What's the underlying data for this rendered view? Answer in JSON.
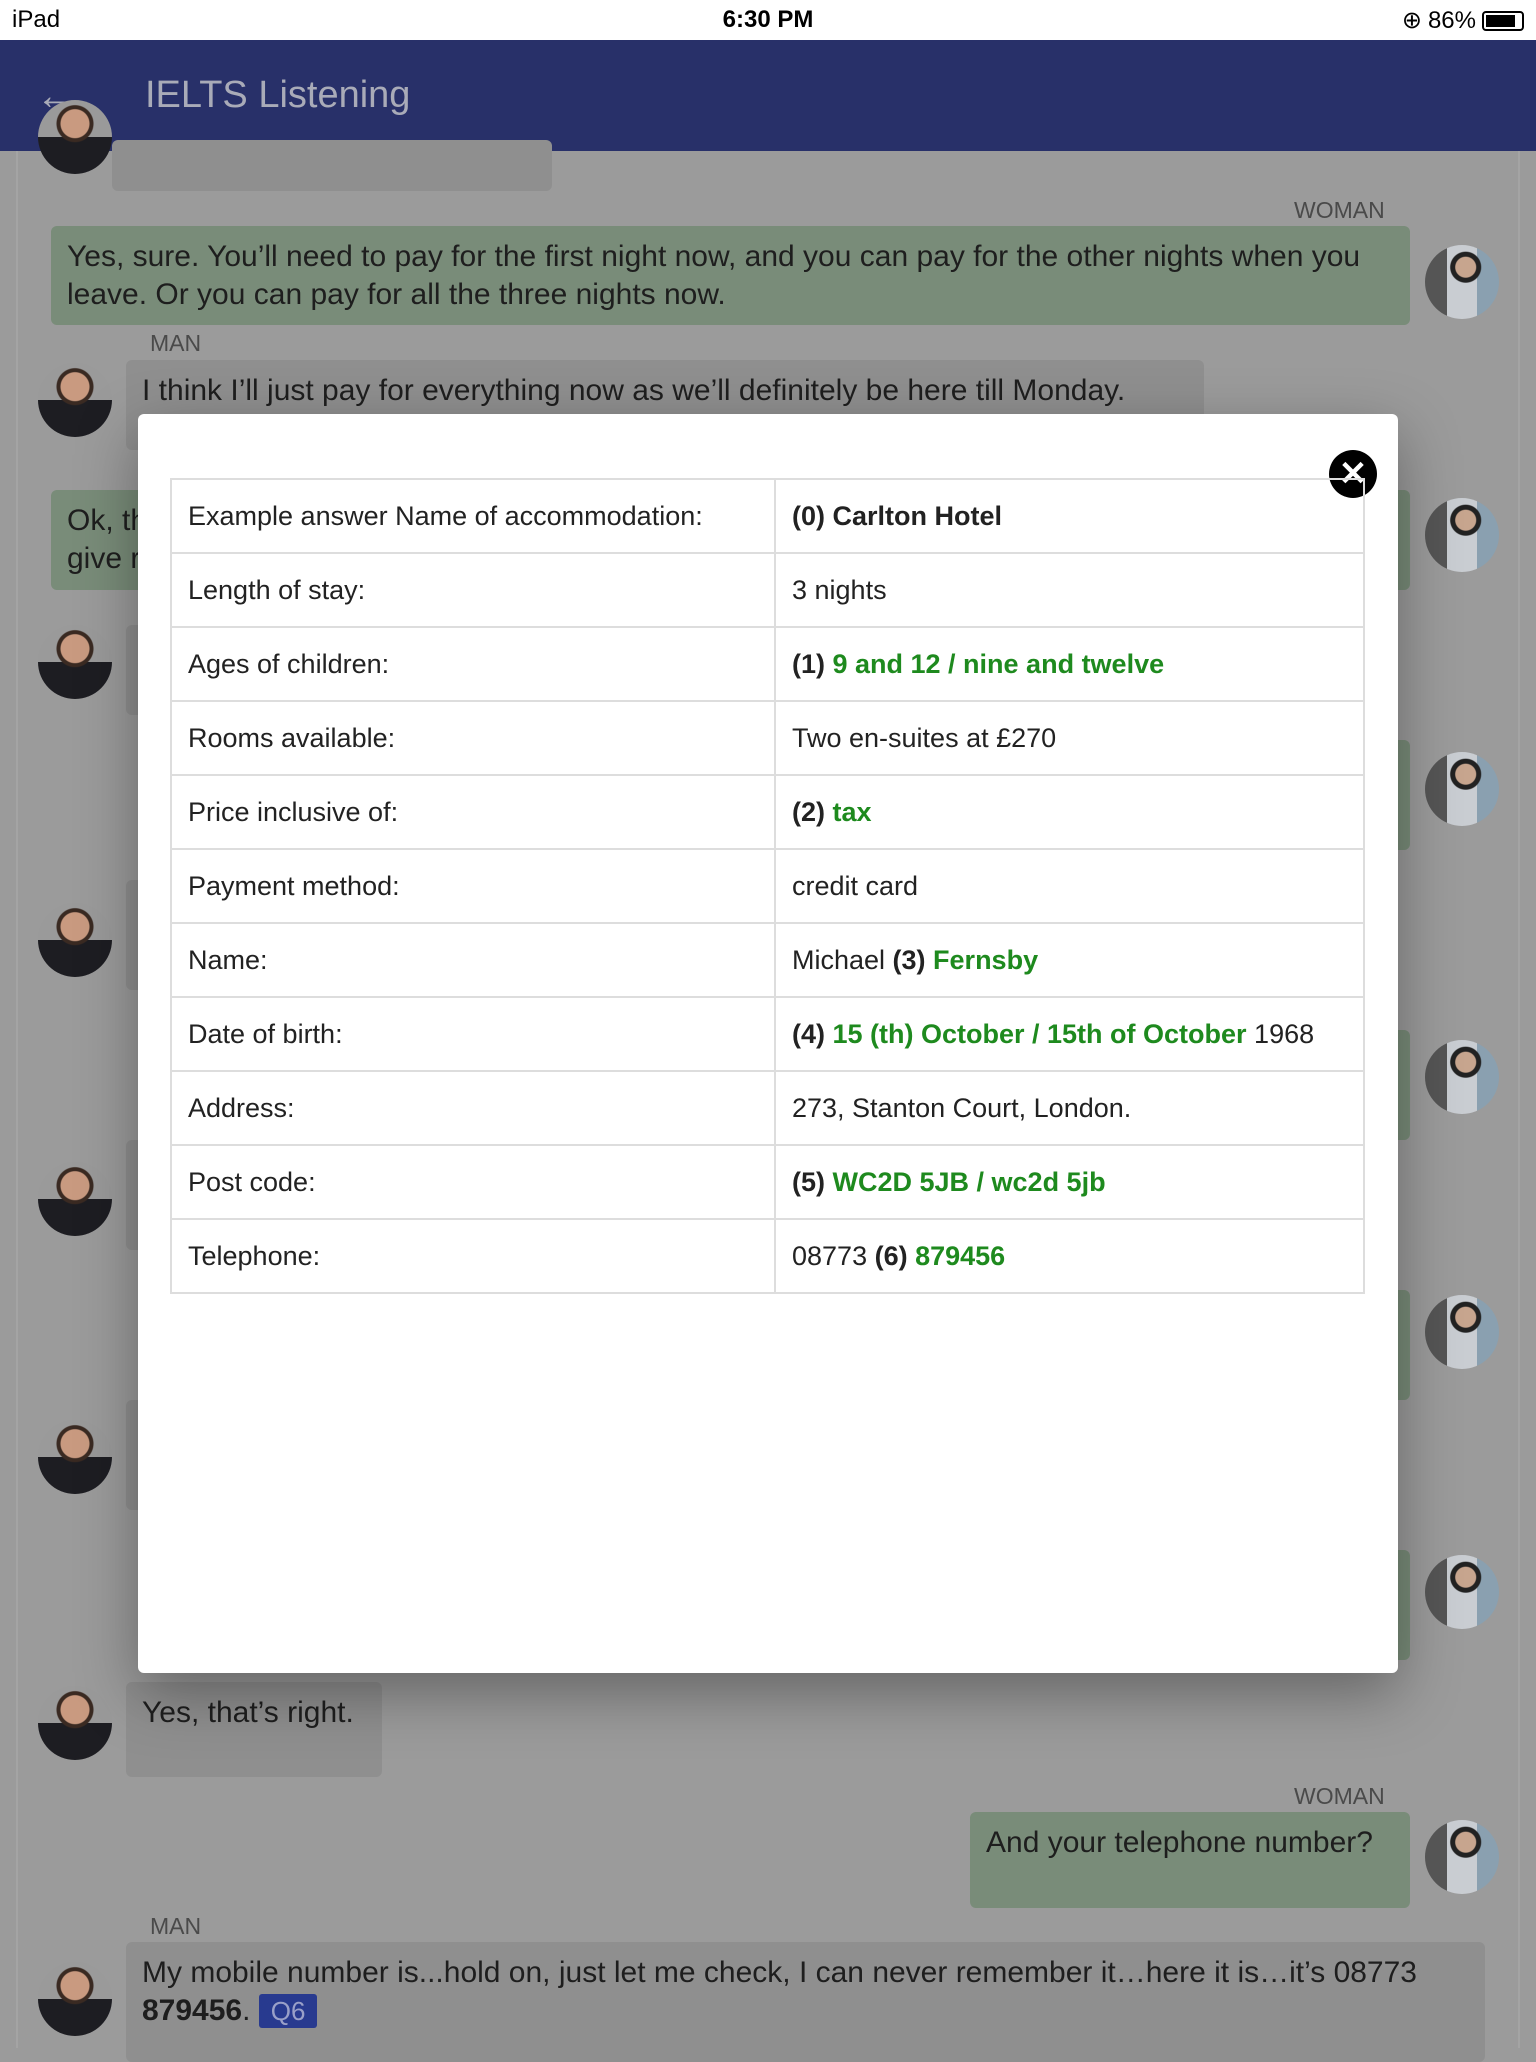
{
  "status": {
    "device": "iPad",
    "time": "6:30 PM",
    "battery": "86%",
    "battery_level": 0.86
  },
  "header": {
    "title": "IELTS Listening",
    "back_icon": "arrow-left-icon"
  },
  "chat": {
    "woman_label": "WOMAN",
    "man_label": "MAN",
    "msg1": "Yes, sure. You’ll need to pay for the first night now, and you can pay for the other nights when you leave. Or you can pay for all the three nights now.",
    "msg2": "I think I’ll just pay for everything now as we’ll definitely be here till Monday.",
    "msg3a": "Ok, th",
    "msg3b": "give r",
    "msg4": "Yes, that’s right.",
    "msg5": "And your telephone number?",
    "msg6": "My mobile number is...hold on, just let me check, I can never remember it…here it is…it’s 08773 ",
    "msg6_bold": "879456",
    "msg6_end": ".",
    "msg6_badge": "Q6"
  },
  "modal": {
    "close_icon": "close-icon",
    "rows": [
      {
        "label": "Example answer Name of accommodation:",
        "pre": "",
        "num": "(0) ",
        "answer": "",
        "post": "",
        "bold_text": "Carlton Hotel"
      },
      {
        "label": "Length of stay:",
        "pre": "3 nights",
        "num": "",
        "answer": "",
        "post": ""
      },
      {
        "label": "Ages of children:",
        "pre": "",
        "num": "(1) ",
        "answer": "9 and 12 / nine and twelve",
        "post": ""
      },
      {
        "label": "Rooms available:",
        "pre": "Two en-suites at £270",
        "num": "",
        "answer": "",
        "post": ""
      },
      {
        "label": "Price inclusive of:",
        "pre": "",
        "num": "(2) ",
        "answer": "tax",
        "post": ""
      },
      {
        "label": "Payment method:",
        "pre": "credit card",
        "num": "",
        "answer": "",
        "post": ""
      },
      {
        "label": "Name:",
        "pre": "Michael ",
        "num": "(3) ",
        "answer": "Fernsby",
        "post": ""
      },
      {
        "label": "Date of birth:",
        "pre": "",
        "num": "(4) ",
        "answer": "15 (th) October / 15th of October",
        "post": " 1968"
      },
      {
        "label": "Address:",
        "pre": "273, Stanton Court, London.",
        "num": "",
        "answer": "",
        "post": ""
      },
      {
        "label": "Post code:",
        "pre": "",
        "num": "(5) ",
        "answer": "WC2D 5JB / wc2d 5jb",
        "post": ""
      },
      {
        "label": "Telephone:",
        "pre": "08773 ",
        "num": "(6) ",
        "answer": "879456",
        "post": ""
      }
    ]
  },
  "colors": {
    "header": "#283069",
    "answer_green": "#1e8a1e",
    "woman_bubble": "#798c79",
    "man_bubble": "#8f8f8f",
    "badge": "#283a8f"
  }
}
